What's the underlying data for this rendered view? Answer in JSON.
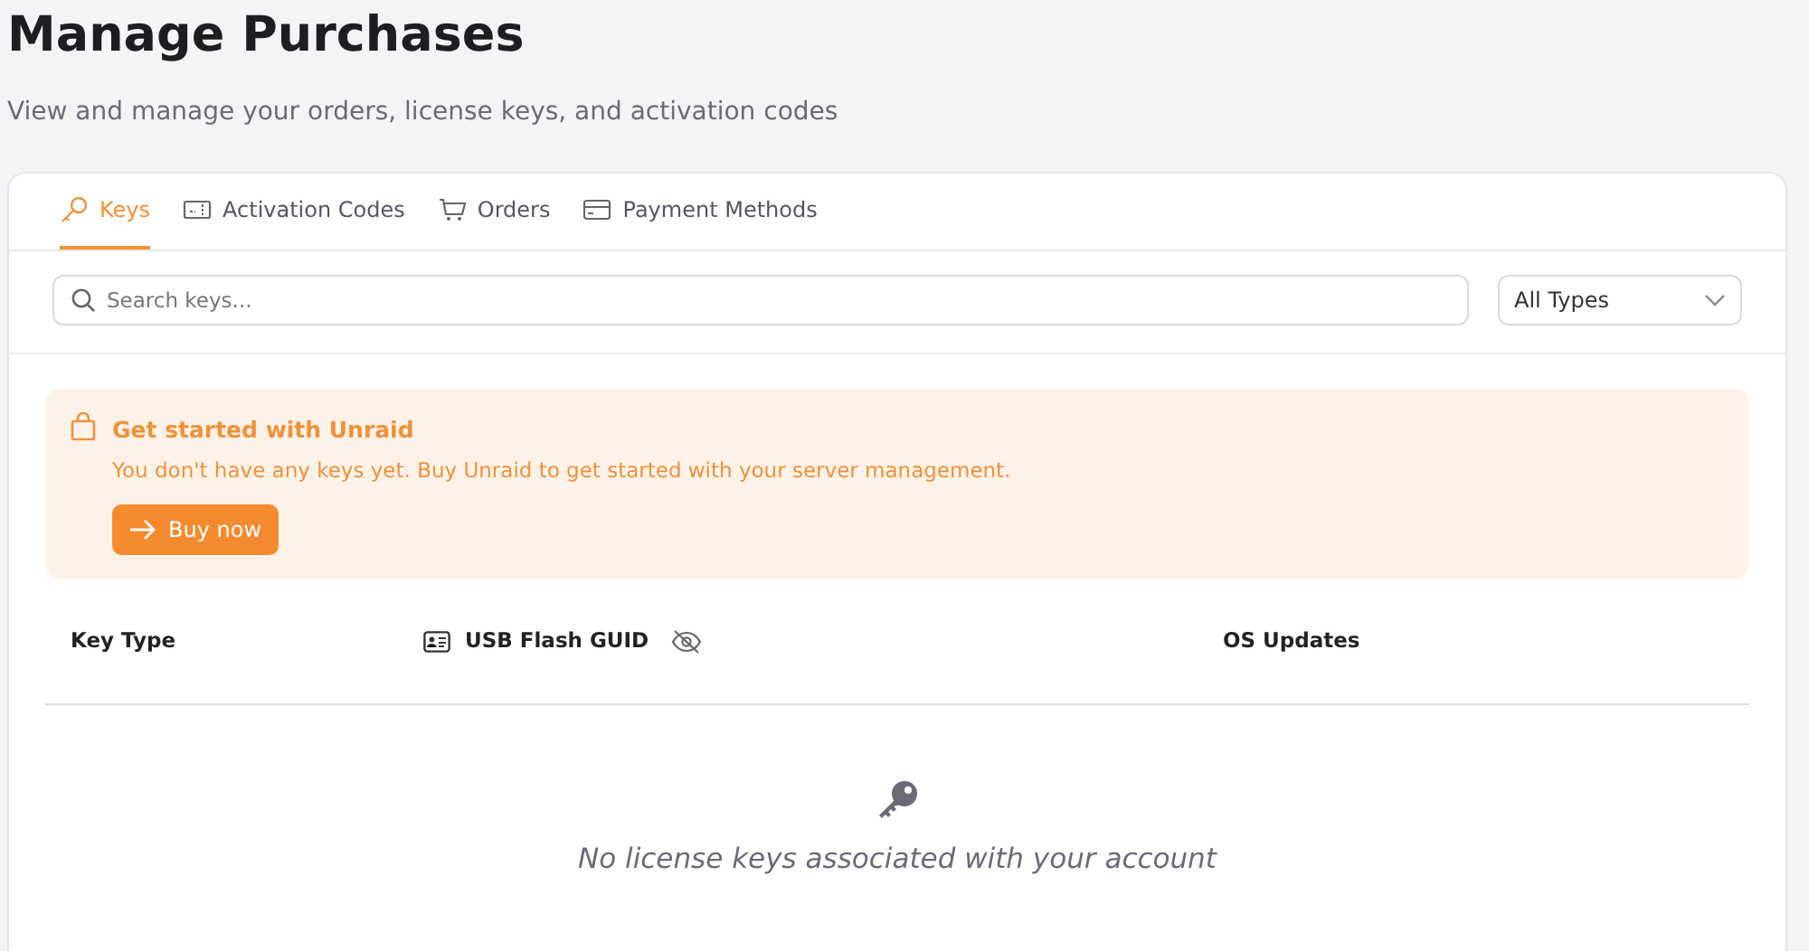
{
  "page": {
    "title": "Manage Purchases",
    "subtitle": "View and manage your orders, license keys, and activation codes"
  },
  "tabs": [
    {
      "label": "Keys",
      "selected": true
    },
    {
      "label": "Activation Codes",
      "selected": false
    },
    {
      "label": "Orders",
      "selected": false
    },
    {
      "label": "Payment Methods",
      "selected": false
    }
  ],
  "search": {
    "placeholder": "Search keys..."
  },
  "type_filter": {
    "value": "All Types"
  },
  "alert": {
    "title": "Get started with Unraid",
    "message": "You don't have any keys yet. Buy Unraid to get started with your server management.",
    "button": "Buy now"
  },
  "table": {
    "columns": [
      "Key Type",
      "USB Flash GUID",
      "OS Updates"
    ],
    "empty_message": "No license keys associated with your account"
  }
}
